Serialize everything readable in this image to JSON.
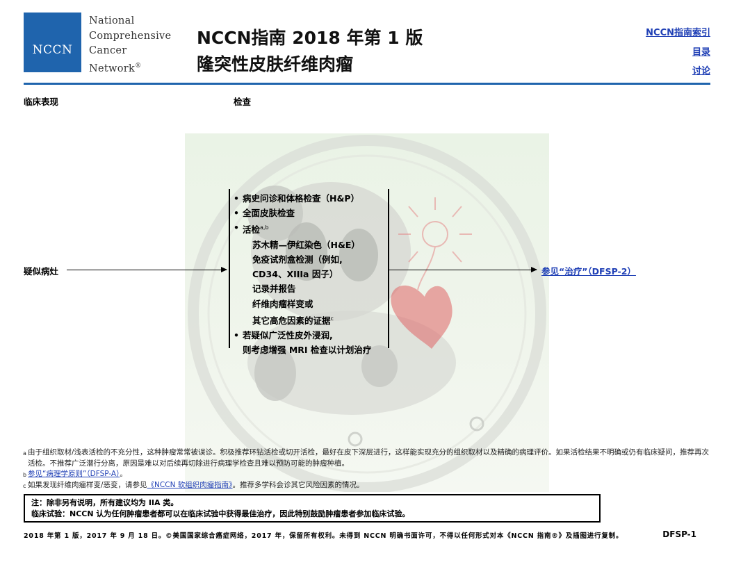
{
  "header": {
    "logo_text": "NCCN",
    "org_lines": [
      "National",
      "Comprehensive",
      "Cancer",
      "Network"
    ],
    "org_registered": "®",
    "title_line1": "NCCN指南 2018 年第 1 版",
    "title_line2": "隆突性皮肤纤维肉瘤",
    "nav": {
      "index": "NCCN指南索引",
      "toc": "目录",
      "discussion": "讨论"
    }
  },
  "columns": {
    "clinical_presentation": "临床表现",
    "workup": "检查"
  },
  "flow": {
    "presentation": "疑似病灶",
    "workup_items": [
      {
        "type": "bullet",
        "glyph": "•",
        "text": "病史问诊和体格检查（H&P）"
      },
      {
        "type": "bullet",
        "glyph": "•",
        "text": "全面皮肤检查"
      },
      {
        "type": "bullet",
        "glyph": "•",
        "text": "活检",
        "sup": "a,b"
      },
      {
        "type": "sub",
        "glyph": "",
        "text": "苏木精—伊红染色（H&E）"
      },
      {
        "type": "sub",
        "glyph": "",
        "text": "免疫试剂盒检测（例如,"
      },
      {
        "type": "cont",
        "text": "CD34、XIIIa 因子）"
      },
      {
        "type": "sub",
        "glyph": "",
        "text": "记录并报告"
      },
      {
        "type": "cont",
        "text": "纤维肉瘤样变或"
      },
      {
        "type": "cont",
        "text": "其它高危因素的证据",
        "sup": "c"
      },
      {
        "type": "bullet",
        "glyph": "•",
        "text": "若疑似广泛性皮外浸润,"
      },
      {
        "type": "cont2",
        "text": "则考虑增强 MRI 检查以计划治疗"
      }
    ],
    "treatment_link": "参见“治疗”（DFSP-2）"
  },
  "footnotes": {
    "a_mark": "a",
    "a_text": "由于组织取材/浅表活检的不充分性，这种肿瘤常常被误诊。积极推荐环钻活检或切开活检，最好在皮下深层进行，这样能实现充分的组织取材以及精确的病理评价。如果活检结果不明确或仍有临床疑问，推荐再次活检。不推荐广泛潜行分离，原因是难以对后续再切除进行病理学检查且难以预防可能的肿瘤种植。",
    "b_mark": "b",
    "b_link": "参见“病理学原则”（DFSP-A）",
    "b_tail": "。",
    "c_mark": "c",
    "c_pre": "如果发现纤维肉瘤样变/恶变，请参见",
    "c_link": "《NCCN 软组织肉瘤指南》",
    "c_tail": "。推荐多学科会诊其它风险因素的情况。"
  },
  "note": {
    "line1": "注：除非另有说明，所有建议均为 IIA 类。",
    "line2": "临床试验：NCCN 认为任何肿瘤患者都可以在临床试验中获得最佳治疗，因此特别鼓励肿瘤患者参加临床试验。"
  },
  "footer": {
    "copyright": "2018 年第 1 版，2017 年 9 月 18 日。©美国国家综合癌症网络，2017 年，保留所有权利。未得到 NCCN 明确书面许可，不得以任何形式对本《NCCN 指南®》及插图进行复制。",
    "page_code": "DFSP-1"
  },
  "colors": {
    "brand_blue": "#1f64ad",
    "link_blue": "#1f3fb5",
    "watermark_bg": "#eaf3e6",
    "watermark_heart": "#e07070"
  },
  "icons": {
    "watermark": "panda-heart-watermark"
  }
}
